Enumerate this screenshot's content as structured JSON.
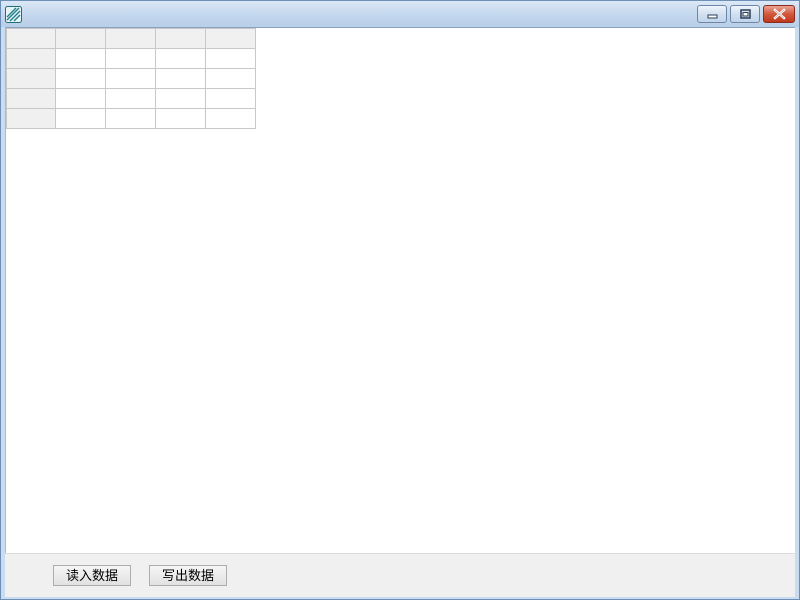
{
  "window": {
    "title": "",
    "icon": "app-icon",
    "controls": [
      "minimize-icon",
      "maximize-icon",
      "close-icon"
    ]
  },
  "grid": {
    "columns": 5,
    "rows": 5,
    "cells": [
      [
        "",
        "",
        "",
        "",
        ""
      ],
      [
        "",
        "",
        "",
        "",
        ""
      ],
      [
        "",
        "",
        "",
        "",
        ""
      ],
      [
        "",
        "",
        "",
        "",
        ""
      ],
      [
        "",
        "",
        "",
        "",
        ""
      ]
    ]
  },
  "footer": {
    "read_button_label": "读入数据",
    "write_button_label": "写出数据"
  },
  "colors": {
    "titlebar": "#c3d7ee",
    "close_button": "#c0391d",
    "header_cell": "#f0f0f0",
    "grid_line": "#c8c8c8"
  }
}
